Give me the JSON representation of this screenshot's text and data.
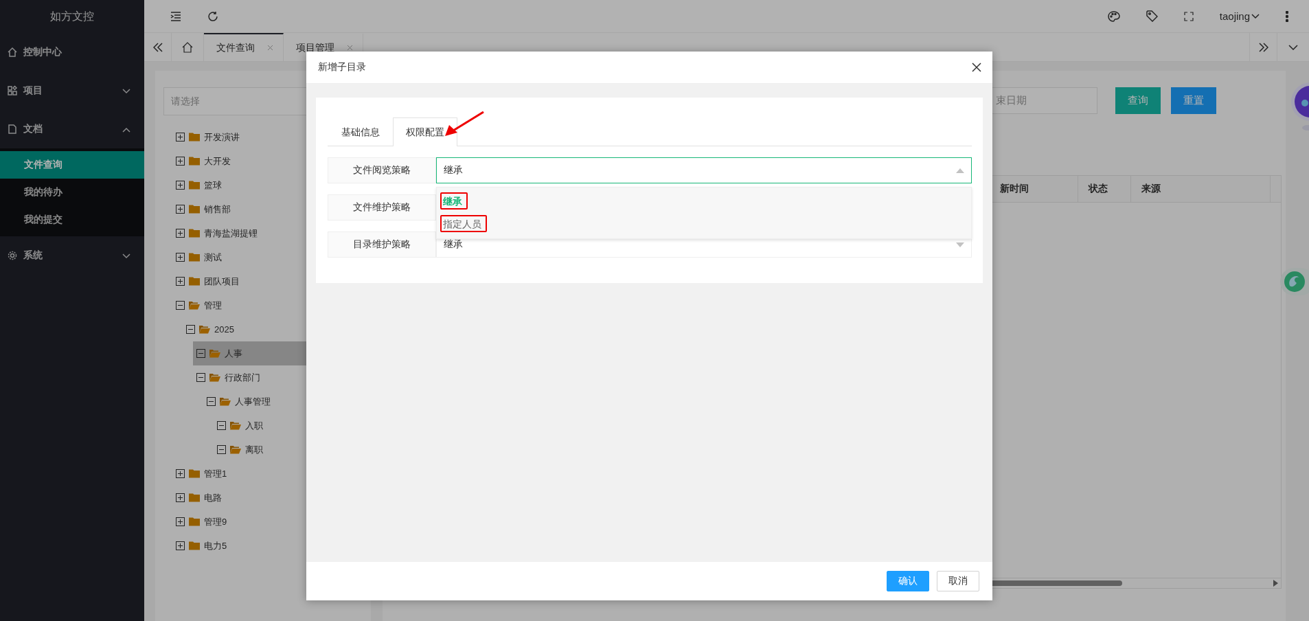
{
  "app": {
    "logo": "如方文控"
  },
  "sidebar": {
    "items": [
      {
        "label": "控制中心",
        "kind": "link"
      },
      {
        "label": "项目",
        "kind": "group",
        "expanded": false
      },
      {
        "label": "文档",
        "kind": "group",
        "expanded": true,
        "children": [
          {
            "label": "文件查询",
            "selected": true
          },
          {
            "label": "我的待办",
            "selected": false
          },
          {
            "label": "我的提交",
            "selected": false
          }
        ]
      },
      {
        "label": "系统",
        "kind": "group",
        "expanded": false
      }
    ]
  },
  "header": {
    "user": "taojing"
  },
  "tabs": [
    {
      "label": "文件查询",
      "selected": true
    },
    {
      "label": "项目管理",
      "selected": false
    }
  ],
  "filter": {
    "placeholder": "请选择"
  },
  "tree": [
    {
      "label": "开发演讲",
      "expanded": false,
      "selected": false
    },
    {
      "label": "大开发",
      "expanded": false,
      "selected": false
    },
    {
      "label": "篮球",
      "expanded": false,
      "selected": false
    },
    {
      "label": "销售部",
      "expanded": false,
      "selected": false
    },
    {
      "label": "青海盐湖提锂",
      "expanded": false,
      "selected": false
    },
    {
      "label": "测试",
      "expanded": false,
      "selected": false
    },
    {
      "label": "团队项目",
      "expanded": false,
      "selected": false
    },
    {
      "label": "管理",
      "expanded": true,
      "selected": false,
      "children": [
        {
          "label": "2025",
          "expanded": true,
          "selected": false,
          "children": [
            {
              "label": "人事",
              "expanded": true,
              "selected": true
            },
            {
              "label": "行政部门",
              "expanded": true,
              "selected": false,
              "children": [
                {
                  "label": "人事管理",
                  "expanded": true,
                  "selected": false,
                  "children": [
                    {
                      "label": "入职",
                      "expanded": true,
                      "selected": false
                    },
                    {
                      "label": "离职",
                      "expanded": true,
                      "selected": false
                    }
                  ]
                }
              ]
            }
          ]
        }
      ]
    },
    {
      "label": "管理1",
      "expanded": false,
      "selected": false
    },
    {
      "label": "电路",
      "expanded": false,
      "selected": false
    },
    {
      "label": "管理9",
      "expanded": false,
      "selected": false
    },
    {
      "label": "电力5",
      "expanded": false,
      "selected": false
    }
  ],
  "search": {
    "date_placeholder": "束日期",
    "buttons": [
      {
        "label": "查询",
        "kind": "primary"
      },
      {
        "label": "重置",
        "kind": "secondary"
      }
    ]
  },
  "table": {
    "columns": [
      "新时间",
      "状态",
      "来源"
    ]
  },
  "dialog": {
    "title": "新增子目录",
    "tabs": [
      {
        "label": "基础信息",
        "selected": false
      },
      {
        "label": "权限配置",
        "selected": true
      }
    ],
    "fields": [
      {
        "label": "文件阅览策略",
        "value": "继承",
        "open": true,
        "options": [
          {
            "label": "继承",
            "selected": true
          },
          {
            "label": "指定人员",
            "selected": false
          }
        ]
      },
      {
        "label": "文件维护策略"
      },
      {
        "label": "目录维护策略",
        "value": "继承",
        "open": false
      }
    ],
    "buttons": [
      {
        "label": "确认",
        "kind": "primary"
      },
      {
        "label": "取消",
        "kind": "default"
      }
    ]
  }
}
